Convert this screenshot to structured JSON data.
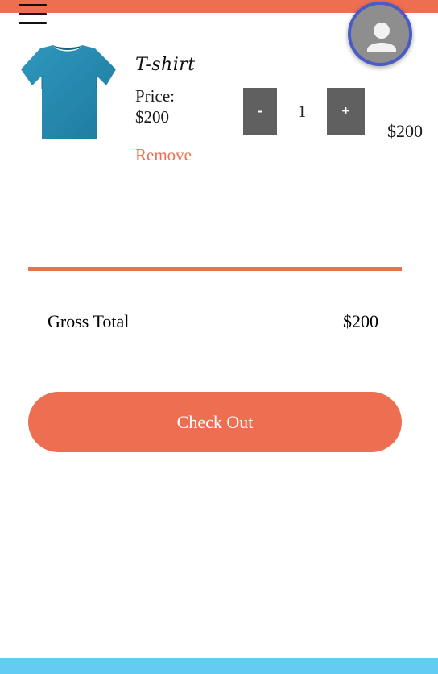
{
  "header": {
    "menu_icon": "hamburger-menu-icon",
    "avatar_icon": "user-avatar-icon",
    "accent_color": "#ee6e52",
    "avatar_border_color": "#4a5ac6"
  },
  "cart": {
    "items": [
      {
        "image_icon": "tshirt-product-image",
        "image_color": "#2a8fb5",
        "name": "T-shirt",
        "price_label": "Price:",
        "price_value": "$200",
        "remove_label": "Remove",
        "minus_label": "-",
        "plus_label": "+",
        "quantity": "1",
        "line_total": "$200"
      }
    ]
  },
  "summary": {
    "gross_total_label": "Gross Total",
    "gross_total_value": "$200"
  },
  "actions": {
    "checkout_label": "Check Out"
  },
  "footer": {
    "bar_color": "#63ccf5"
  }
}
